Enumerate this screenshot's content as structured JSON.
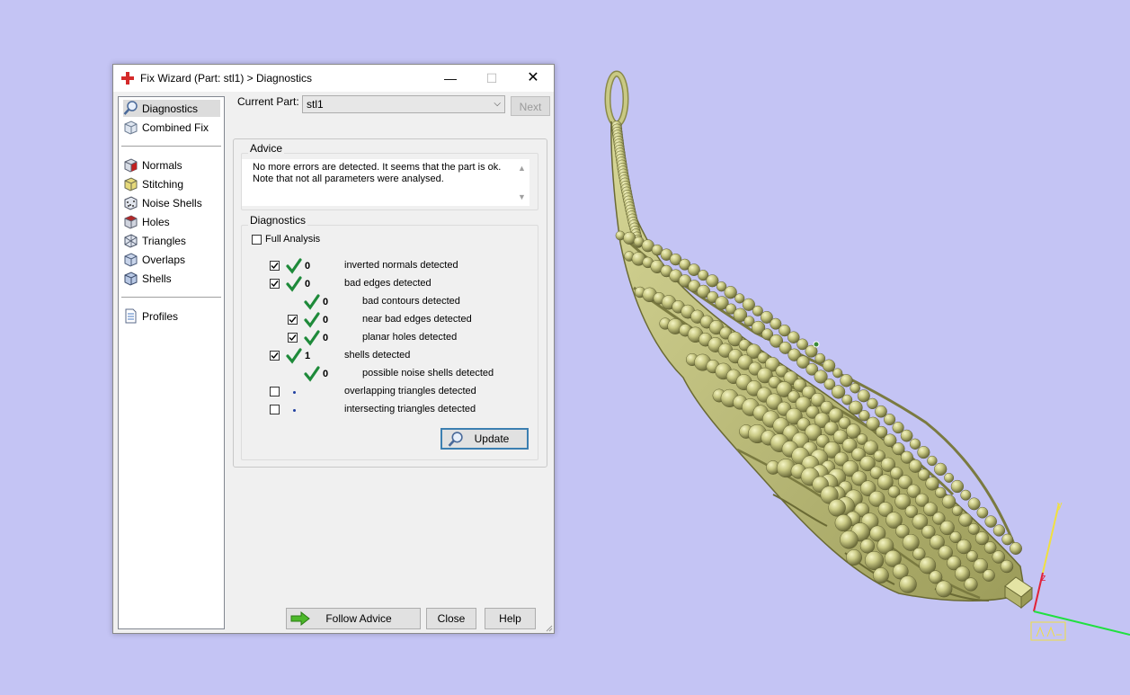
{
  "window": {
    "title": "Fix Wizard (Part: stl1) > Diagnostics",
    "minimize_glyph": "—",
    "maximize_glyph": "☐",
    "close_glyph": "✕"
  },
  "nav": {
    "items": [
      {
        "label": "Diagnostics",
        "icon": "magnifier-icon",
        "selected": true
      },
      {
        "label": "Combined Fix",
        "icon": "cube-icon"
      },
      {
        "label": "Normals",
        "icon": "cube-red-icon"
      },
      {
        "label": "Stitching",
        "icon": "cube-yellow-icon"
      },
      {
        "label": "Noise Shells",
        "icon": "cube-dots-icon"
      },
      {
        "label": "Holes",
        "icon": "cube-holes-icon"
      },
      {
        "label": "Triangles",
        "icon": "triangles-icon"
      },
      {
        "label": "Overlaps",
        "icon": "cube-overlap-icon"
      },
      {
        "label": "Shells",
        "icon": "cube-blue-icon"
      },
      {
        "label": "Profiles",
        "icon": "document-icon"
      }
    ]
  },
  "header": {
    "current_part_label": "Current Part:",
    "current_part_value": "stl1",
    "next_label": "Next"
  },
  "advice": {
    "title": "Advice",
    "line1": "No more errors are detected. It seems that the part is ok.",
    "line2": "Note that not all parameters were analysed."
  },
  "diagnostics": {
    "title": "Diagnostics",
    "full_analysis_label": "Full Analysis",
    "full_analysis_checked": false,
    "rows": [
      {
        "checked": true,
        "status": "ok",
        "count": "0",
        "label": "inverted normals detected"
      },
      {
        "checked": true,
        "status": "ok",
        "count": "0",
        "label": "bad edges detected"
      },
      {
        "status": "ok",
        "count": "0",
        "label": "bad contours detected"
      },
      {
        "checked": true,
        "status": "ok",
        "count": "0",
        "label": "near bad edges detected"
      },
      {
        "checked": true,
        "status": "ok",
        "count": "0",
        "label": "planar holes detected"
      },
      {
        "checked": true,
        "status": "ok",
        "count": "1",
        "label": "shells detected"
      },
      {
        "status": "ok",
        "count": "0",
        "label": "possible noise shells detected"
      },
      {
        "checked": false,
        "status": "not-run",
        "count": "",
        "label": "overlapping triangles detected"
      },
      {
        "checked": false,
        "status": "not-run",
        "count": "",
        "label": "intersecting triangles detected"
      }
    ],
    "update_label": "Update"
  },
  "footer": {
    "follow_advice_label": "Follow Advice",
    "close_label": "Close",
    "help_label": "Help"
  },
  "viewport": {
    "axis_y_label": "y",
    "axis_z_label": "z",
    "model_color": "#c4c47a",
    "background": "#c4c4f4"
  }
}
